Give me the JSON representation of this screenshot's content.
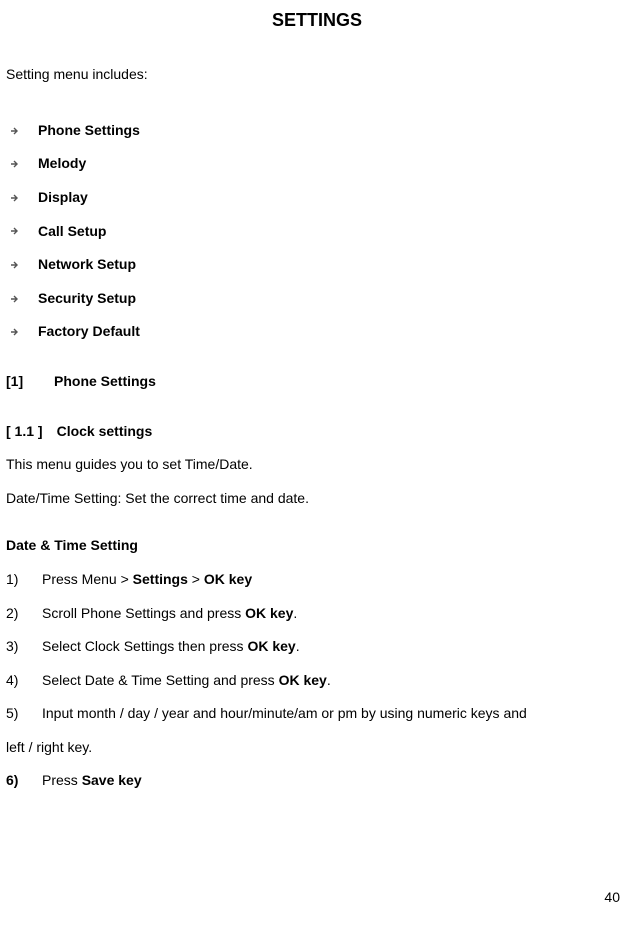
{
  "title": "SETTINGS",
  "intro": "Setting menu includes:",
  "menu": [
    "Phone Settings",
    "Melody",
    "Display",
    "Call Setup",
    "Network Setup",
    "Security Setup",
    "Factory Default"
  ],
  "section": {
    "num": "[1]",
    "label": "Phone Settings"
  },
  "subsection": {
    "num": "[ 1.1 ]",
    "label": "Clock settings"
  },
  "para1": "This menu guides you to set Time/Date.",
  "para2": "Date/Time Setting: Set the correct time and date.",
  "subTitle": "Date  &  Time Setting",
  "steps": {
    "s1": {
      "num": "1)",
      "pre": "Press Menu > ",
      "b1": "Settings",
      "mid": " > ",
      "b2": "OK key"
    },
    "s2": {
      "num": "2)",
      "pre": "Scroll Phone Settings and press ",
      "b1": "OK key",
      "post": "."
    },
    "s3": {
      "num": "3)",
      "pre": "Select Clock Settings then press ",
      "b1": "OK key",
      "post": "."
    },
    "s4": {
      "num": "4)",
      "pre": "Select Date & Time Setting and press ",
      "b1": "OK key",
      "post": "."
    },
    "s5": {
      "num": "5)",
      "text": "Input month / day / year and hour/minute/am or pm by using numeric keys and"
    },
    "s5b": "left / right key.",
    "s6": {
      "num": "6)",
      "pre": "Press ",
      "b1": "Save key"
    }
  },
  "pageNumber": "40"
}
